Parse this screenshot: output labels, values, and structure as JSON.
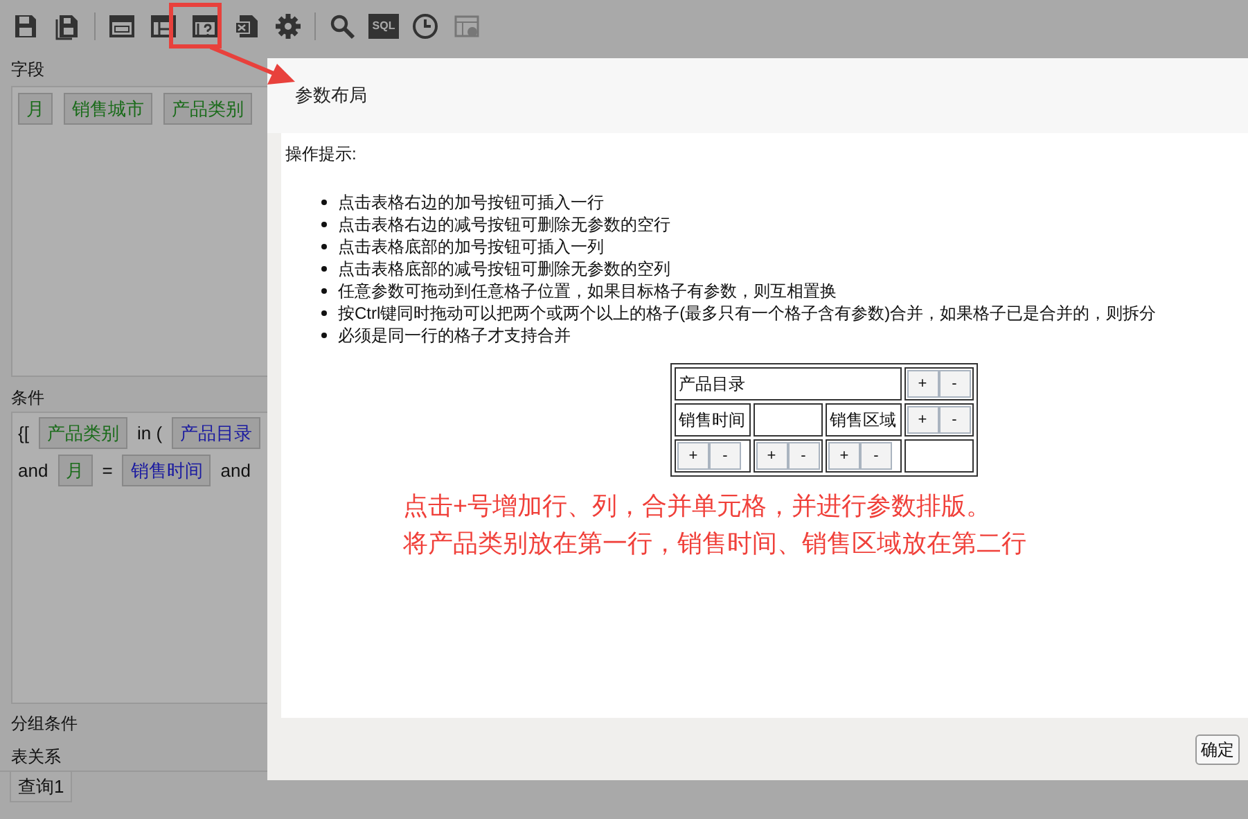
{
  "toolbar": [
    [
      {
        "kind": "save"
      },
      {
        "kind": "save_as"
      }
    ],
    [
      {
        "kind": "layout"
      },
      {
        "kind": "layout_grid"
      },
      {
        "kind": "param_layout"
      },
      {
        "kind": "export"
      },
      {
        "kind": "settings"
      }
    ],
    [
      {
        "kind": "search"
      },
      {
        "kind": "sql",
        "label": "SQL"
      },
      {
        "kind": "clock"
      },
      {
        "kind": "disabled_grid"
      }
    ]
  ],
  "fields": {
    "title": "字段",
    "chips": [
      {
        "label": "月",
        "color": "#1a6b1a"
      },
      {
        "label": "销售城市",
        "color": "#1a6b1a"
      },
      {
        "label": "产品类别",
        "color": "#1a6b1a"
      }
    ]
  },
  "conditions": {
    "title": "条件",
    "lines": [
      [
        {
          "kind": "text",
          "text": "{["
        },
        {
          "kind": "chip",
          "text": "产品类别",
          "color": "#1a6b1a"
        },
        {
          "kind": "text",
          "text": "in ("
        },
        {
          "kind": "chip",
          "text": "产品目录",
          "color": "#1a1aa0"
        }
      ],
      [
        {
          "kind": "text",
          "text": "and"
        },
        {
          "kind": "chip",
          "text": "月",
          "color": "#1a6b1a"
        },
        {
          "kind": "text",
          "text": "="
        },
        {
          "kind": "chip",
          "text": "销售时间",
          "color": "#1a1aa0"
        },
        {
          "kind": "text",
          "text": "and"
        }
      ]
    ]
  },
  "group_conditions": {
    "title": "分组条件"
  },
  "table_relations": {
    "title": "表关系"
  },
  "tabs": [
    {
      "label": "查询1",
      "selected": true
    }
  ],
  "dialog": {
    "title": "参数布局",
    "hint_title": "操作提示:",
    "hints": [
      "点击表格右边的加号按钮可插入一行",
      "点击表格右边的减号按钮可删除无参数的空行",
      "点击表格底部的加号按钮可插入一列",
      "点击表格底部的减号按钮可删除无参数的空列",
      "任意参数可拖动到任意格子位置，如果目标格子有参数，则互相置换",
      "按Ctrl键同时拖动可以把两个或两个以上的格子(最多只有一个格子含有参数)合并，如果格子已是合并的，则拆分",
      "必须是同一行的格子才支持合并"
    ],
    "grid": [
      [
        {
          "kind": "param",
          "text": "产品目录",
          "wide": true
        },
        {
          "kind": "buttons",
          "plus": "+",
          "minus": "-"
        }
      ],
      [
        {
          "kind": "param",
          "text": "销售时间"
        },
        {
          "kind": "empty"
        },
        {
          "kind": "param",
          "text": "销售区域"
        },
        {
          "kind": "buttons",
          "plus": "+",
          "minus": "-"
        }
      ],
      [
        {
          "kind": "buttons",
          "plus": "+",
          "minus": "-"
        },
        {
          "kind": "buttons",
          "plus": "+",
          "minus": "-"
        },
        {
          "kind": "buttons",
          "plus": "+",
          "minus": "-"
        },
        {
          "kind": "empty"
        }
      ]
    ],
    "annotation": [
      "点击+号增加行、列，合并单元格，并进行参数排版。",
      "将产品类别放在第一行，销售时间、销售区域放在第二行"
    ],
    "ok_button": "确定"
  }
}
